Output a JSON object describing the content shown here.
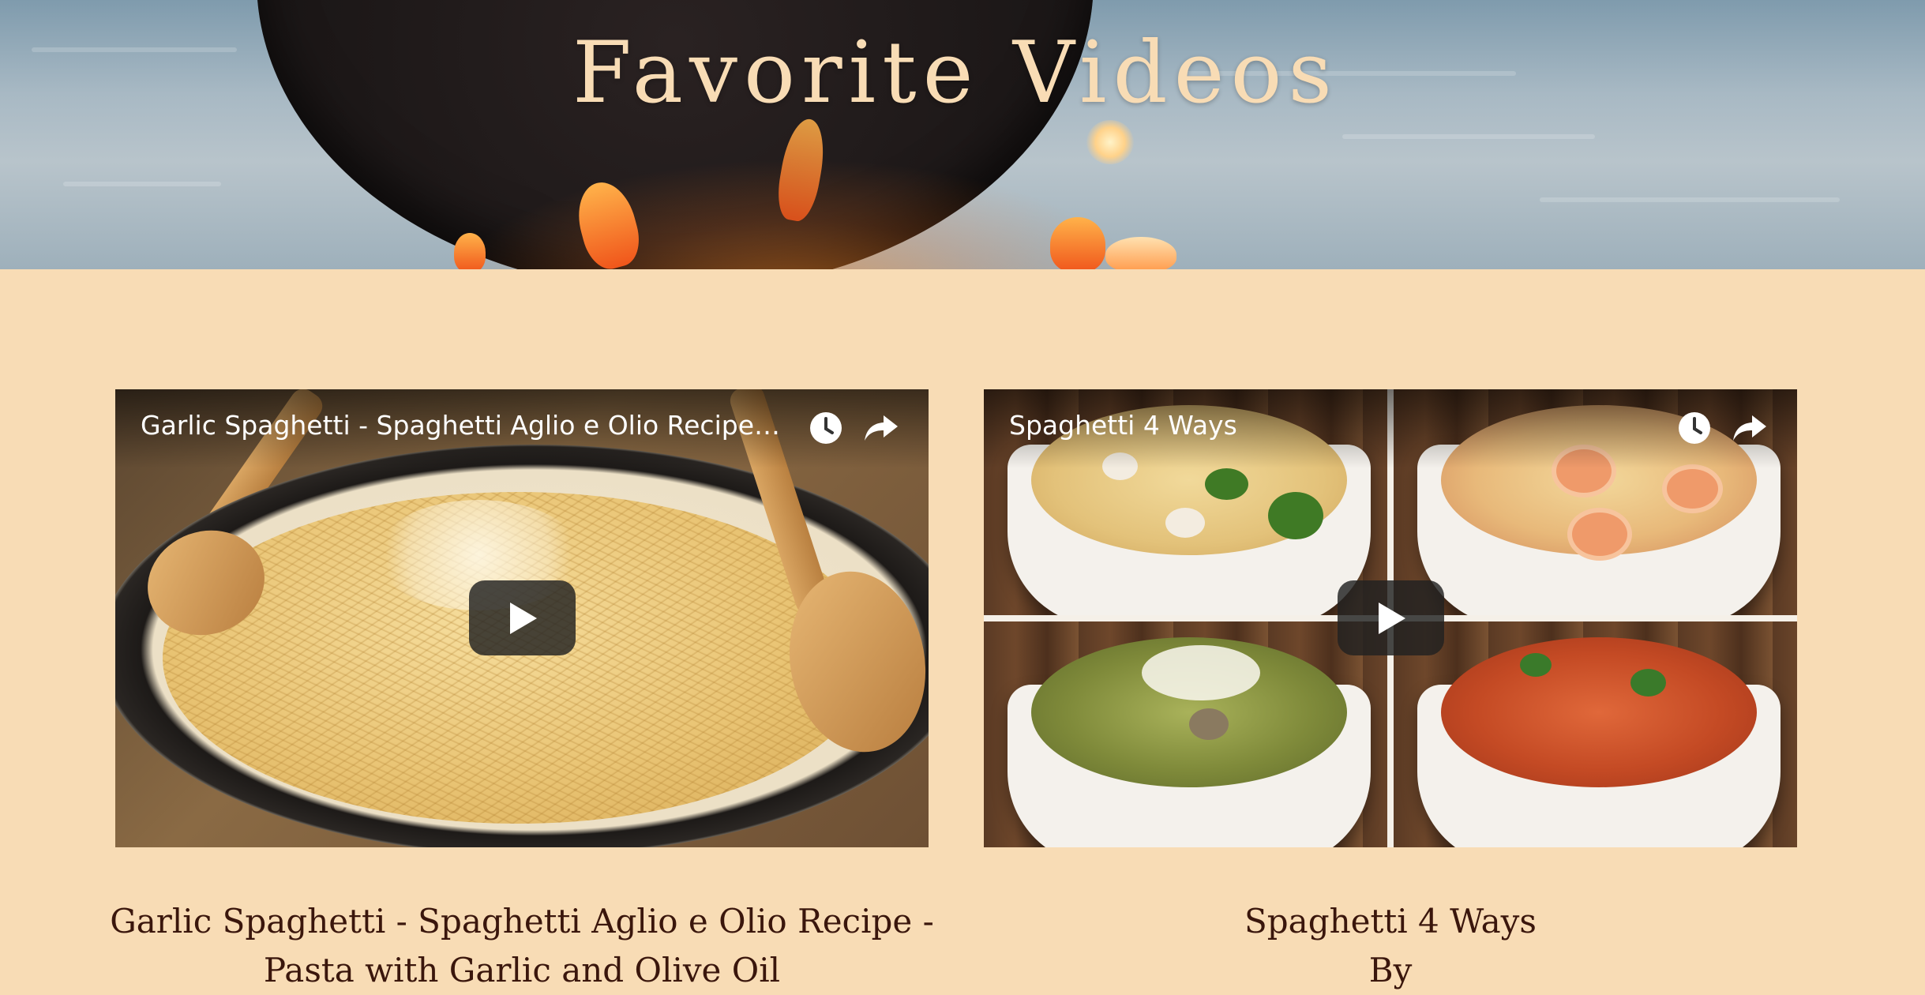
{
  "page": {
    "title": "Favorite Videos",
    "background_color": "#f8dcb5",
    "title_color": "#f8dcb5",
    "caption_color": "#3a160c"
  },
  "videos": [
    {
      "overlay_title": "Garlic Spaghetti - Spaghetti Aglio e Olio Recipe - P...",
      "caption": "Garlic Spaghetti - Spaghetti Aglio e Olio Recipe - Pasta with Garlic and Olive Oil",
      "watch_later_icon": "clock-icon",
      "share_icon": "share-arrow-icon",
      "play_icon": "play-icon"
    },
    {
      "overlay_title": "Spaghetti 4 Ways",
      "caption": "Spaghetti 4 Ways",
      "caption_byline": "By",
      "watch_later_icon": "clock-icon",
      "share_icon": "share-arrow-icon",
      "play_icon": "play-icon"
    }
  ]
}
